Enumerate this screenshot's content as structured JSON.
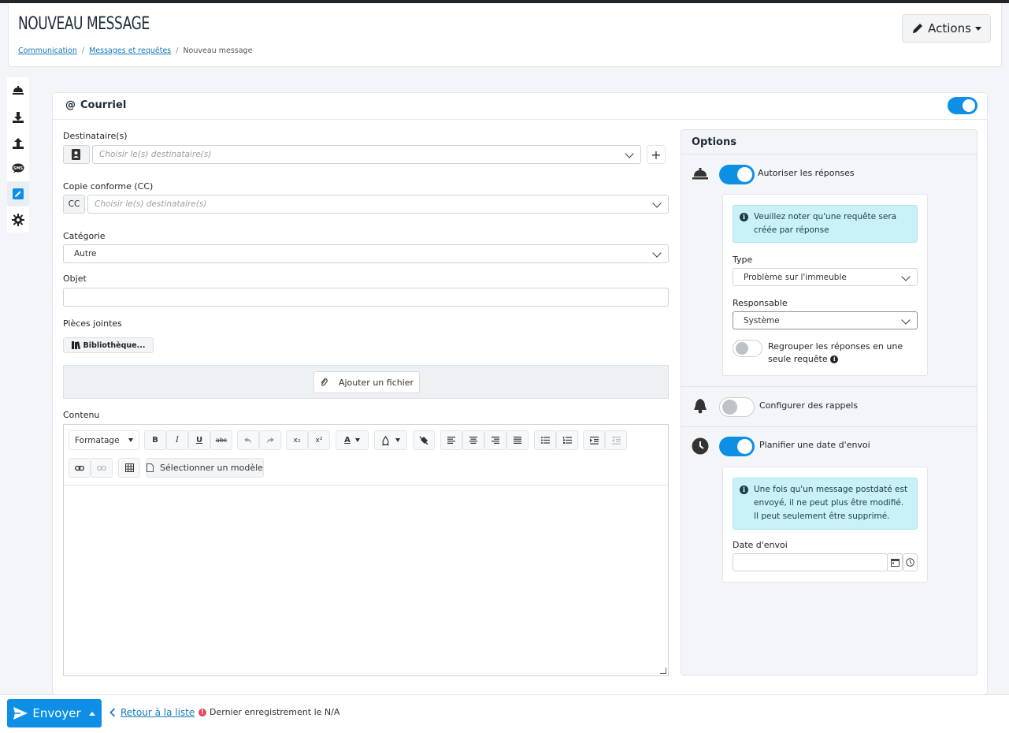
{
  "page": {
    "title": "NOUVEAU MESSAGE",
    "breadcrumb": [
      "Communication",
      "Messages et requêtes",
      "Nouveau message"
    ],
    "actions_label": "Actions"
  },
  "sidenav": {
    "items": [
      "bell-icon",
      "download-icon",
      "upload-icon",
      "sms-icon",
      "edit-icon",
      "gear-icon"
    ],
    "active": "edit-icon"
  },
  "email": {
    "header": "Courriel",
    "enabled": true,
    "recipients_label": "Destinataire(s)",
    "recipients_placeholder": "Choisir le(s) destinataire(s)",
    "cc_label": "Copie conforme (CC)",
    "cc_addon": "CC",
    "cc_placeholder": "Choisir le(s) destinataire(s)",
    "category_label": "Catégorie",
    "category_value": "Autre",
    "subject_label": "Objet",
    "subject_value": "",
    "attachments_label": "Pièces jointes",
    "library_button": "Bibliothèque...",
    "add_file_button": "Ajouter un fichier",
    "content_label": "Contenu",
    "toolbar": {
      "format_label": "Formatage",
      "bold": "B",
      "italic": "I",
      "underline": "U",
      "strike": "abc",
      "subscript": "x₂",
      "superscript": "x²",
      "font_color": "A",
      "template_button": "Sélectionner un modèle"
    }
  },
  "options": {
    "title": "Options",
    "allow_replies": {
      "label": "Autoriser les réponses",
      "enabled": true,
      "info": "Veuillez noter qu'une requête sera créée par réponse",
      "type_label": "Type",
      "type_value": "Problème sur l'immeuble",
      "responsible_label": "Responsable",
      "responsible_value": "Système",
      "group_label": "Regrouper les réponses en une seule requête",
      "group_enabled": false
    },
    "reminders": {
      "label": "Configurer des rappels",
      "enabled": false
    },
    "schedule": {
      "label": "Planifier une date d'envoi",
      "enabled": true,
      "info": "Une fois qu'un message postdaté est envoyé, il ne peut plus être modifié. Il peut seulement être supprimé.",
      "date_label": "Date d'envoi",
      "date_value": ""
    }
  },
  "footer": {
    "send_label": "Envoyer",
    "back_label": "Retour à la liste",
    "last_save": "Dernier enregistrement le N/A"
  },
  "colors": {
    "primary": "#0d8fe6",
    "info_bg": "#c9f1f7",
    "error": "#e04a5c"
  }
}
